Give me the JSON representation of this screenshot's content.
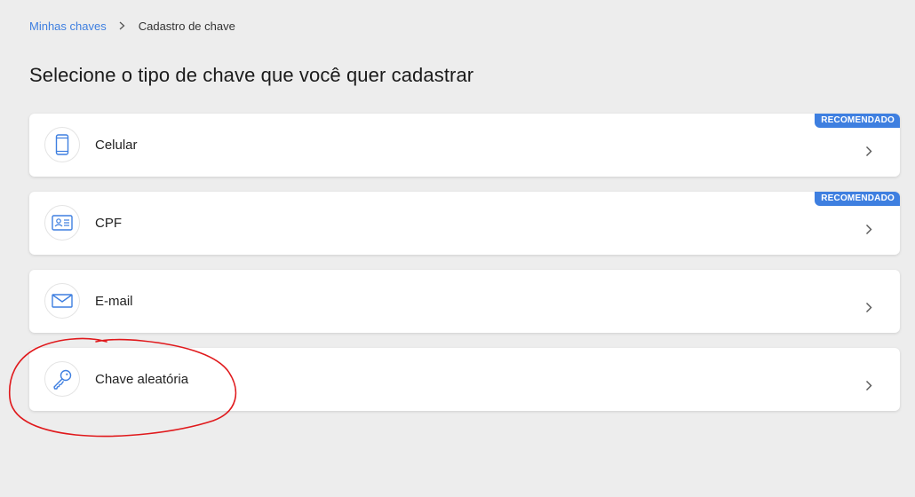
{
  "breadcrumb": {
    "parent": "Minhas chaves",
    "current": "Cadastro de chave"
  },
  "page": {
    "title": "Selecione o tipo de chave que você quer cadastrar"
  },
  "key_types": [
    {
      "label": "Celular",
      "icon": "phone-icon",
      "badge": "RECOMENDADO"
    },
    {
      "label": "CPF",
      "icon": "id-card-icon",
      "badge": "RECOMENDADO"
    },
    {
      "label": "E-mail",
      "icon": "envelope-icon",
      "badge": ""
    },
    {
      "label": "Chave aleatória",
      "icon": "key-icon",
      "badge": ""
    }
  ],
  "colors": {
    "accent": "#3e7fe0",
    "background": "#ededed",
    "card": "#ffffff",
    "annotation": "#e0191c"
  }
}
